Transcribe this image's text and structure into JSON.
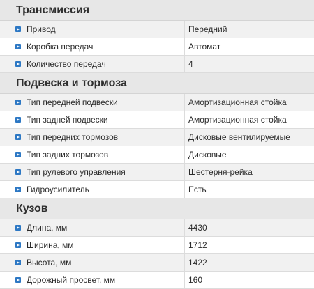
{
  "sections": [
    {
      "title": "Трансмиссия",
      "rows": [
        {
          "label": "Привод",
          "value": "Передний"
        },
        {
          "label": "Коробка передач",
          "value": "Автомат"
        },
        {
          "label": "Количество передач",
          "value": "4"
        }
      ]
    },
    {
      "title": "Подвеска и тормоза",
      "rows": [
        {
          "label": "Тип передней подвески",
          "value": "Амортизационная стойка"
        },
        {
          "label": "Тип задней подвески",
          "value": "Амортизационная стойка"
        },
        {
          "label": "Тип передних тормозов",
          "value": "Дисковые вентилируемые"
        },
        {
          "label": "Тип задних тормозов",
          "value": "Дисковые"
        },
        {
          "label": "Тип рулевого управления",
          "value": "Шестерня-рейка"
        },
        {
          "label": "Гидроусилитель",
          "value": "Есть"
        }
      ]
    },
    {
      "title": "Кузов",
      "rows": [
        {
          "label": "Длина, мм",
          "value": "4430"
        },
        {
          "label": "Ширина, мм",
          "value": "1712"
        },
        {
          "label": "Высота, мм",
          "value": "1422"
        },
        {
          "label": "Дорожный просвет, мм",
          "value": "160"
        }
      ]
    }
  ],
  "icons": {
    "bullet": "arrow-right-bullet-icon"
  },
  "colors": {
    "header_bg": "#e7e7e7",
    "row_alt_bg": "#f1f1f1",
    "row_bg": "#ffffff",
    "bullet": "#2d78c4",
    "border": "#dcdcdc"
  }
}
